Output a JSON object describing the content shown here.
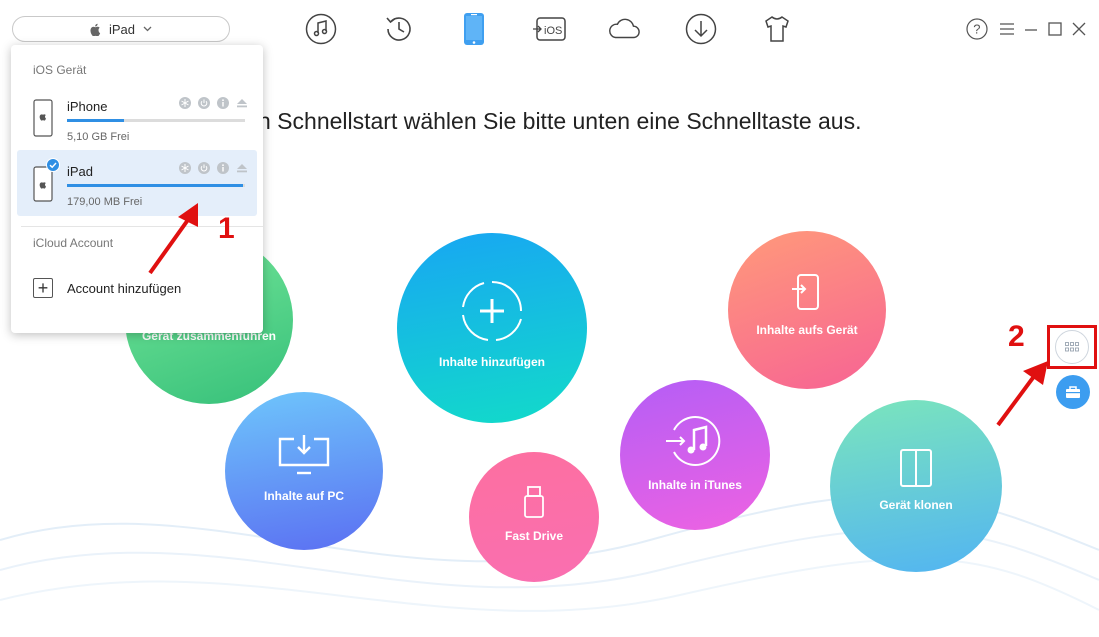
{
  "device_selector": {
    "label": "iPad"
  },
  "nav": {
    "icons": [
      "music-icon",
      "history-icon",
      "device-icon",
      "ios-mover-icon",
      "cloud-icon",
      "download-icon",
      "tshirt-icon"
    ],
    "ios_label": "iOS"
  },
  "window": {
    "icons": [
      "help-icon",
      "menu-icon",
      "minimize-icon",
      "maximize-icon",
      "close-icon"
    ]
  },
  "headline": "n Schnellstart wählen Sie bitte unten eine Schnelltaste aus.",
  "panel": {
    "ios_section": "iOS Gerät",
    "devices": [
      {
        "name": "iPhone",
        "free": "5,10 GB Frei",
        "usage_fraction": 0.32,
        "selected": false
      },
      {
        "name": "iPad",
        "free": "179,00 MB Frei",
        "usage_fraction": 0.99,
        "selected": true
      }
    ],
    "icloud_section": "iCloud Account",
    "add_account": "Account hinzufügen"
  },
  "actions": [
    {
      "id": "merge",
      "label": "Gerät zusammenführen",
      "icon": "merge-icon"
    },
    {
      "id": "add-content",
      "label": "Inhalte hinzufügen",
      "icon": "plus-circle-icon"
    },
    {
      "id": "to-device",
      "label": "Inhalte aufs Gerät",
      "icon": "to-device-icon"
    },
    {
      "id": "to-pc",
      "label": "Inhalte auf PC",
      "icon": "computer-icon"
    },
    {
      "id": "fast-drive",
      "label": "Fast Drive",
      "icon": "usb-drive-icon"
    },
    {
      "id": "to-itunes",
      "label": "Inhalte in iTunes",
      "icon": "itunes-icon"
    },
    {
      "id": "clone",
      "label": "Gerät klonen",
      "icon": "clone-icon"
    }
  ],
  "annotations": {
    "marker_1": "1",
    "marker_2": "2"
  },
  "colors": {
    "accent": "#2f8fe4",
    "marker": "#e01010"
  }
}
